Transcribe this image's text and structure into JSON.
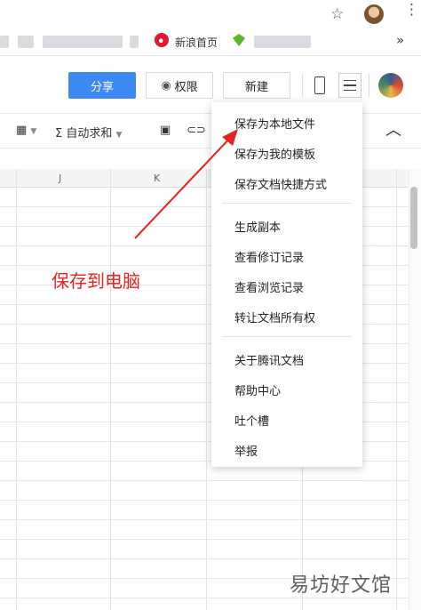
{
  "bookmarks": [
    {
      "label": "新浪首页"
    }
  ],
  "toolbar": {
    "share_label": "分享",
    "permission_label": "权限",
    "new_label": "新建"
  },
  "toolbar2": {
    "autosum_label": "自动求和",
    "sigma": "Σ"
  },
  "columns": [
    "J",
    "K"
  ],
  "menu": {
    "group1": [
      "保存为本地文件",
      "保存为我的模板",
      "保存文档快捷方式"
    ],
    "group2": [
      "生成副本",
      "查看修订记录",
      "查看浏览记录",
      "转让文档所有权"
    ],
    "group3": [
      "关于腾讯文档",
      "帮助中心",
      "吐个槽",
      "举报"
    ]
  },
  "annotation": {
    "text": "保存到电脑",
    "color": "#e52222"
  },
  "watermark": "易坊好文馆",
  "colors": {
    "accent": "#3d8af5"
  }
}
